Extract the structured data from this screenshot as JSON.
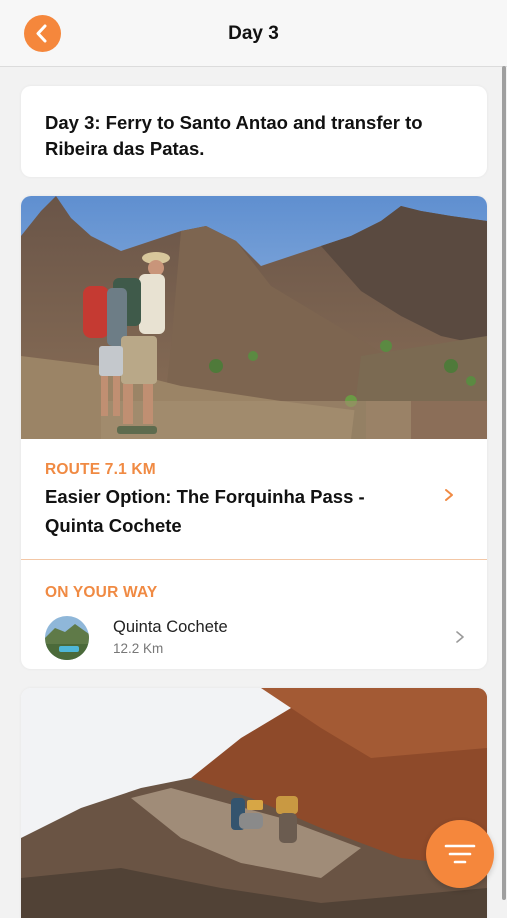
{
  "header": {
    "title": "Day 3",
    "back_icon": "chevron-left-icon",
    "accent_color": "#f5873c"
  },
  "day_card": {
    "title": "Day 3: Ferry to Santo Antao and transfer to Ribeira das Patas."
  },
  "route_card": {
    "image": "hikers-in-mountains-photo",
    "route_label": "ROUTE 7.1 KM",
    "route_title": "Easier Option: The Forquinha Pass - Quinta Cochete",
    "on_your_way_label": "ON YOUR WAY",
    "places": [
      {
        "name": "Quinta Cochete",
        "distance": "12.2 Km"
      }
    ]
  },
  "next_card": {
    "image": "donkeys-on-mountain-trail-photo"
  },
  "fab": {
    "icon": "filter-icon"
  }
}
